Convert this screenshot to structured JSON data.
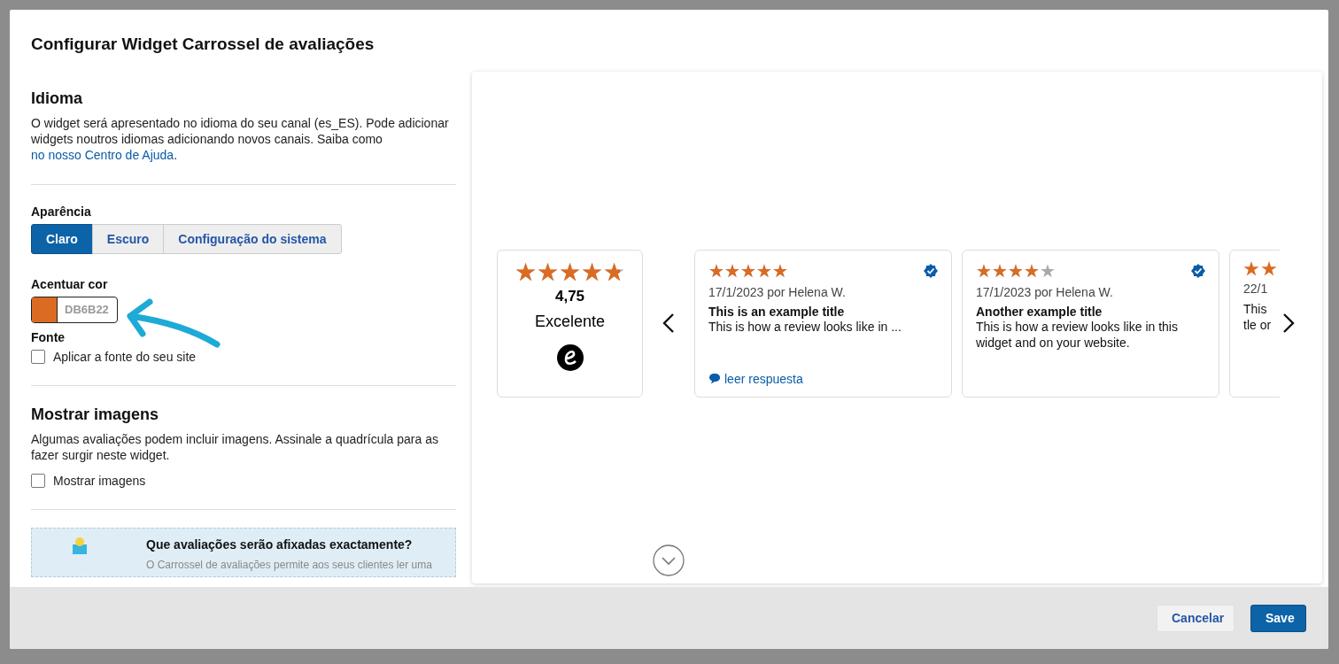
{
  "dialog": {
    "title": "Configurar Widget Carrossel de avaliações"
  },
  "language": {
    "heading": "Idioma",
    "text": "O widget será apresentado no idioma do seu canal (es_ES). Pode adicionar widgets noutros idiomas adicionando novos canais. Saiba como ",
    "link": "no nosso Centro de Ajuda",
    "after": "."
  },
  "appearance": {
    "label": "Aparência",
    "options": [
      {
        "label": "Claro",
        "selected": true
      },
      {
        "label": "Escuro",
        "selected": false
      },
      {
        "label": "Configuração do sistema",
        "selected": false
      }
    ]
  },
  "accent": {
    "label": "Acentuar cor",
    "color": "#db6b22",
    "value": "DB6B22"
  },
  "font": {
    "label": "Fonte",
    "checkbox": {
      "label": "Aplicar a fonte do seu site",
      "checked": false
    }
  },
  "images": {
    "heading": "Mostrar imagens",
    "text": "Algumas avaliações podem incluir imagens. Assinale a quadrícula para as fazer surgir neste widget.",
    "checkbox": {
      "label": "Mostrar imagens",
      "checked": false
    }
  },
  "info": {
    "title": "Que avaliações serão afixadas exactamente?",
    "text": "O Carrossel de avaliações permite aos seus clientes ler uma"
  },
  "preview": {
    "summary": {
      "stars": 4.75,
      "score": "4,75",
      "rating": "Excelente"
    },
    "reviews": [
      {
        "kind": "full",
        "stars": 5,
        "verified": true,
        "meta": "17/1/2023 por Helena W.",
        "title": "This is an example title",
        "lines": [
          "This is how a review looks like in ..."
        ],
        "reply": "leer respuesta"
      },
      {
        "kind": "full",
        "stars": 4,
        "verified": true,
        "meta": "17/1/2023 por Helena W.",
        "title": "Another example title",
        "lines": [
          "This is how a review looks like in this",
          "widget and on your website."
        ]
      },
      {
        "kind": "cut",
        "meta": "22/1",
        "lines": [
          "This",
          "tle or"
        ]
      }
    ]
  },
  "buttons": {
    "cancel": "Cancelar",
    "save": "Save"
  }
}
